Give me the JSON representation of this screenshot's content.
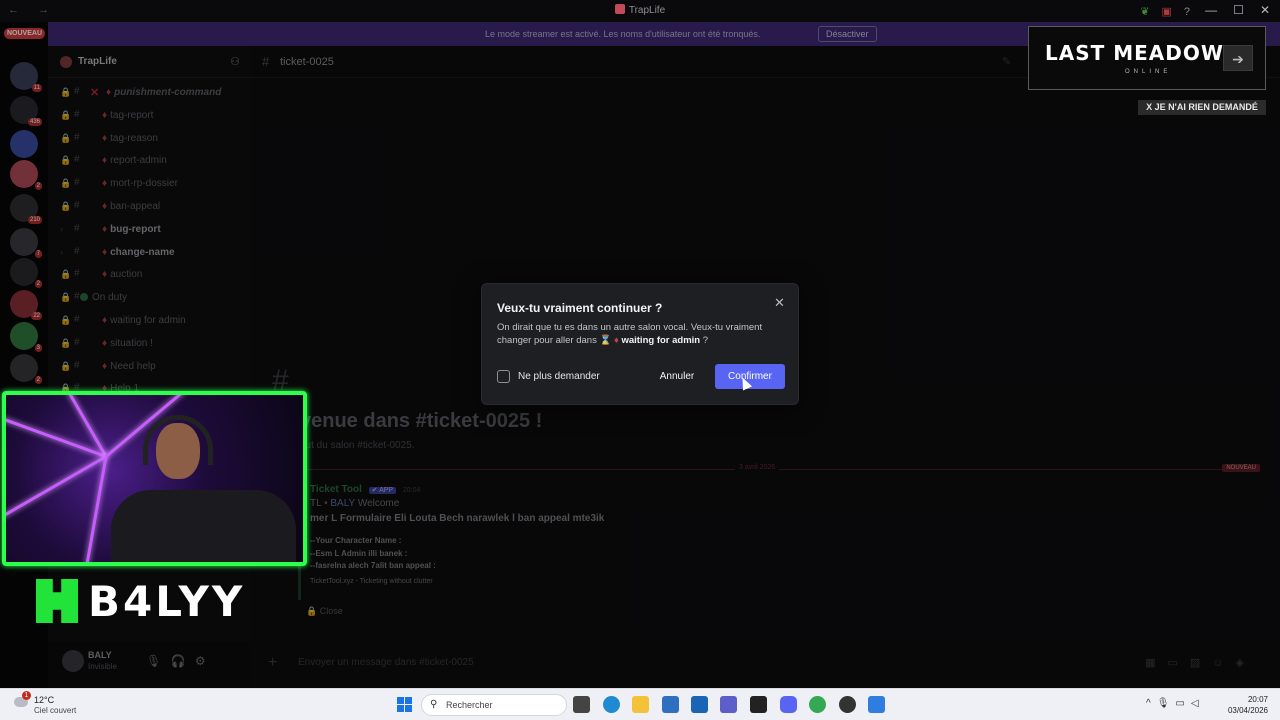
{
  "window": {
    "title": "TrapLife",
    "nav": "← →",
    "controls": [
      "—",
      "☐",
      "✕"
    ]
  },
  "banner": {
    "text": "Le mode streamer est activé. Les noms d'utilisateur ont été tronqués.",
    "button": "Désactiver"
  },
  "rail": {
    "new_badge": "NOUVEAU",
    "badges": [
      "11",
      "436",
      "2",
      "3",
      "210",
      "7",
      "2",
      "22",
      "3",
      "2"
    ]
  },
  "server": {
    "name": "TrapLife"
  },
  "channels": [
    {
      "label": "punishment-command",
      "type": "#",
      "bold": false
    },
    {
      "label": "tag-report",
      "type": "⌛",
      "bold": false
    },
    {
      "label": "tag-reason",
      "type": "⌛",
      "bold": false
    },
    {
      "label": "report-admin",
      "type": "✉",
      "bold": false
    },
    {
      "label": "mort-rp-dossier",
      "type": "✉",
      "bold": false
    },
    {
      "label": "ban-appeal",
      "type": "✉",
      "bold": false
    },
    {
      "label": "bug-report",
      "type": "✉",
      "bold": true
    },
    {
      "label": "change-name",
      "type": "▤",
      "bold": true
    },
    {
      "label": "auction",
      "type": "•",
      "bold": false
    },
    {
      "label": "On duty",
      "type": "",
      "bold": false
    },
    {
      "label": "waiting for admin",
      "type": "⌛",
      "bold": false
    },
    {
      "label": "situation !",
      "type": "⊘",
      "bold": false
    },
    {
      "label": "Need help",
      "type": "⌛",
      "bold": false
    },
    {
      "label": "Help 1",
      "type": "⊘",
      "bold": false
    }
  ],
  "user": {
    "name": "BALY",
    "status": "Invisible"
  },
  "chat": {
    "channel_name": "ticket-0025",
    "welcome_title": "venue dans #ticket-0025 !",
    "welcome_sub": "out du salon #ticket-0025.",
    "divider_date": "3 avril 2026",
    "divider_new": "NOUVEAU",
    "bot_name": "Ticket Tool",
    "app_tag": "✔ APP",
    "time": "20:04",
    "line1_prefix": "TL",
    "line1_user": "BALY",
    "line1_text": "Welcome",
    "line2": "mer L Formulaire Eli Louta Bech narawlek l ban appeal mte3ik",
    "form1": "--Your Character Name :",
    "form2": "--Esm L Admin illi banek :",
    "form3": "--fasrelna alech 7alit ban appeal :",
    "footer": "TicketTool.xyz - Ticketing without clutter",
    "close_label": "Close",
    "composer_placeholder": "Envoyer un message dans #ticket-0025"
  },
  "modal": {
    "title": "Veux-tu vraiment continuer ?",
    "body_text": "On dirait que tu es dans un autre salon vocal. Veux-tu vraiment changer pour aller dans",
    "channel": "waiting for admin",
    "question_mark": "?",
    "checkbox_label": "Ne plus demander",
    "cancel": "Annuler",
    "confirm": "Confirmer",
    "accent": "#5865f2"
  },
  "overlay": {
    "game_title": "LAST MEADOW",
    "game_sub": "ONLINE",
    "note": "X JE N'AI RIEN DEMANDÉ"
  },
  "stream": {
    "logo_text": "B4LYY",
    "accent": "#2dff4d"
  },
  "taskbar": {
    "weather_temp": "12°C",
    "weather_desc": "Ciel couvert",
    "weather_badge": "1",
    "search_placeholder": "Rechercher",
    "time": "20:07",
    "date": "03/04/2026"
  }
}
